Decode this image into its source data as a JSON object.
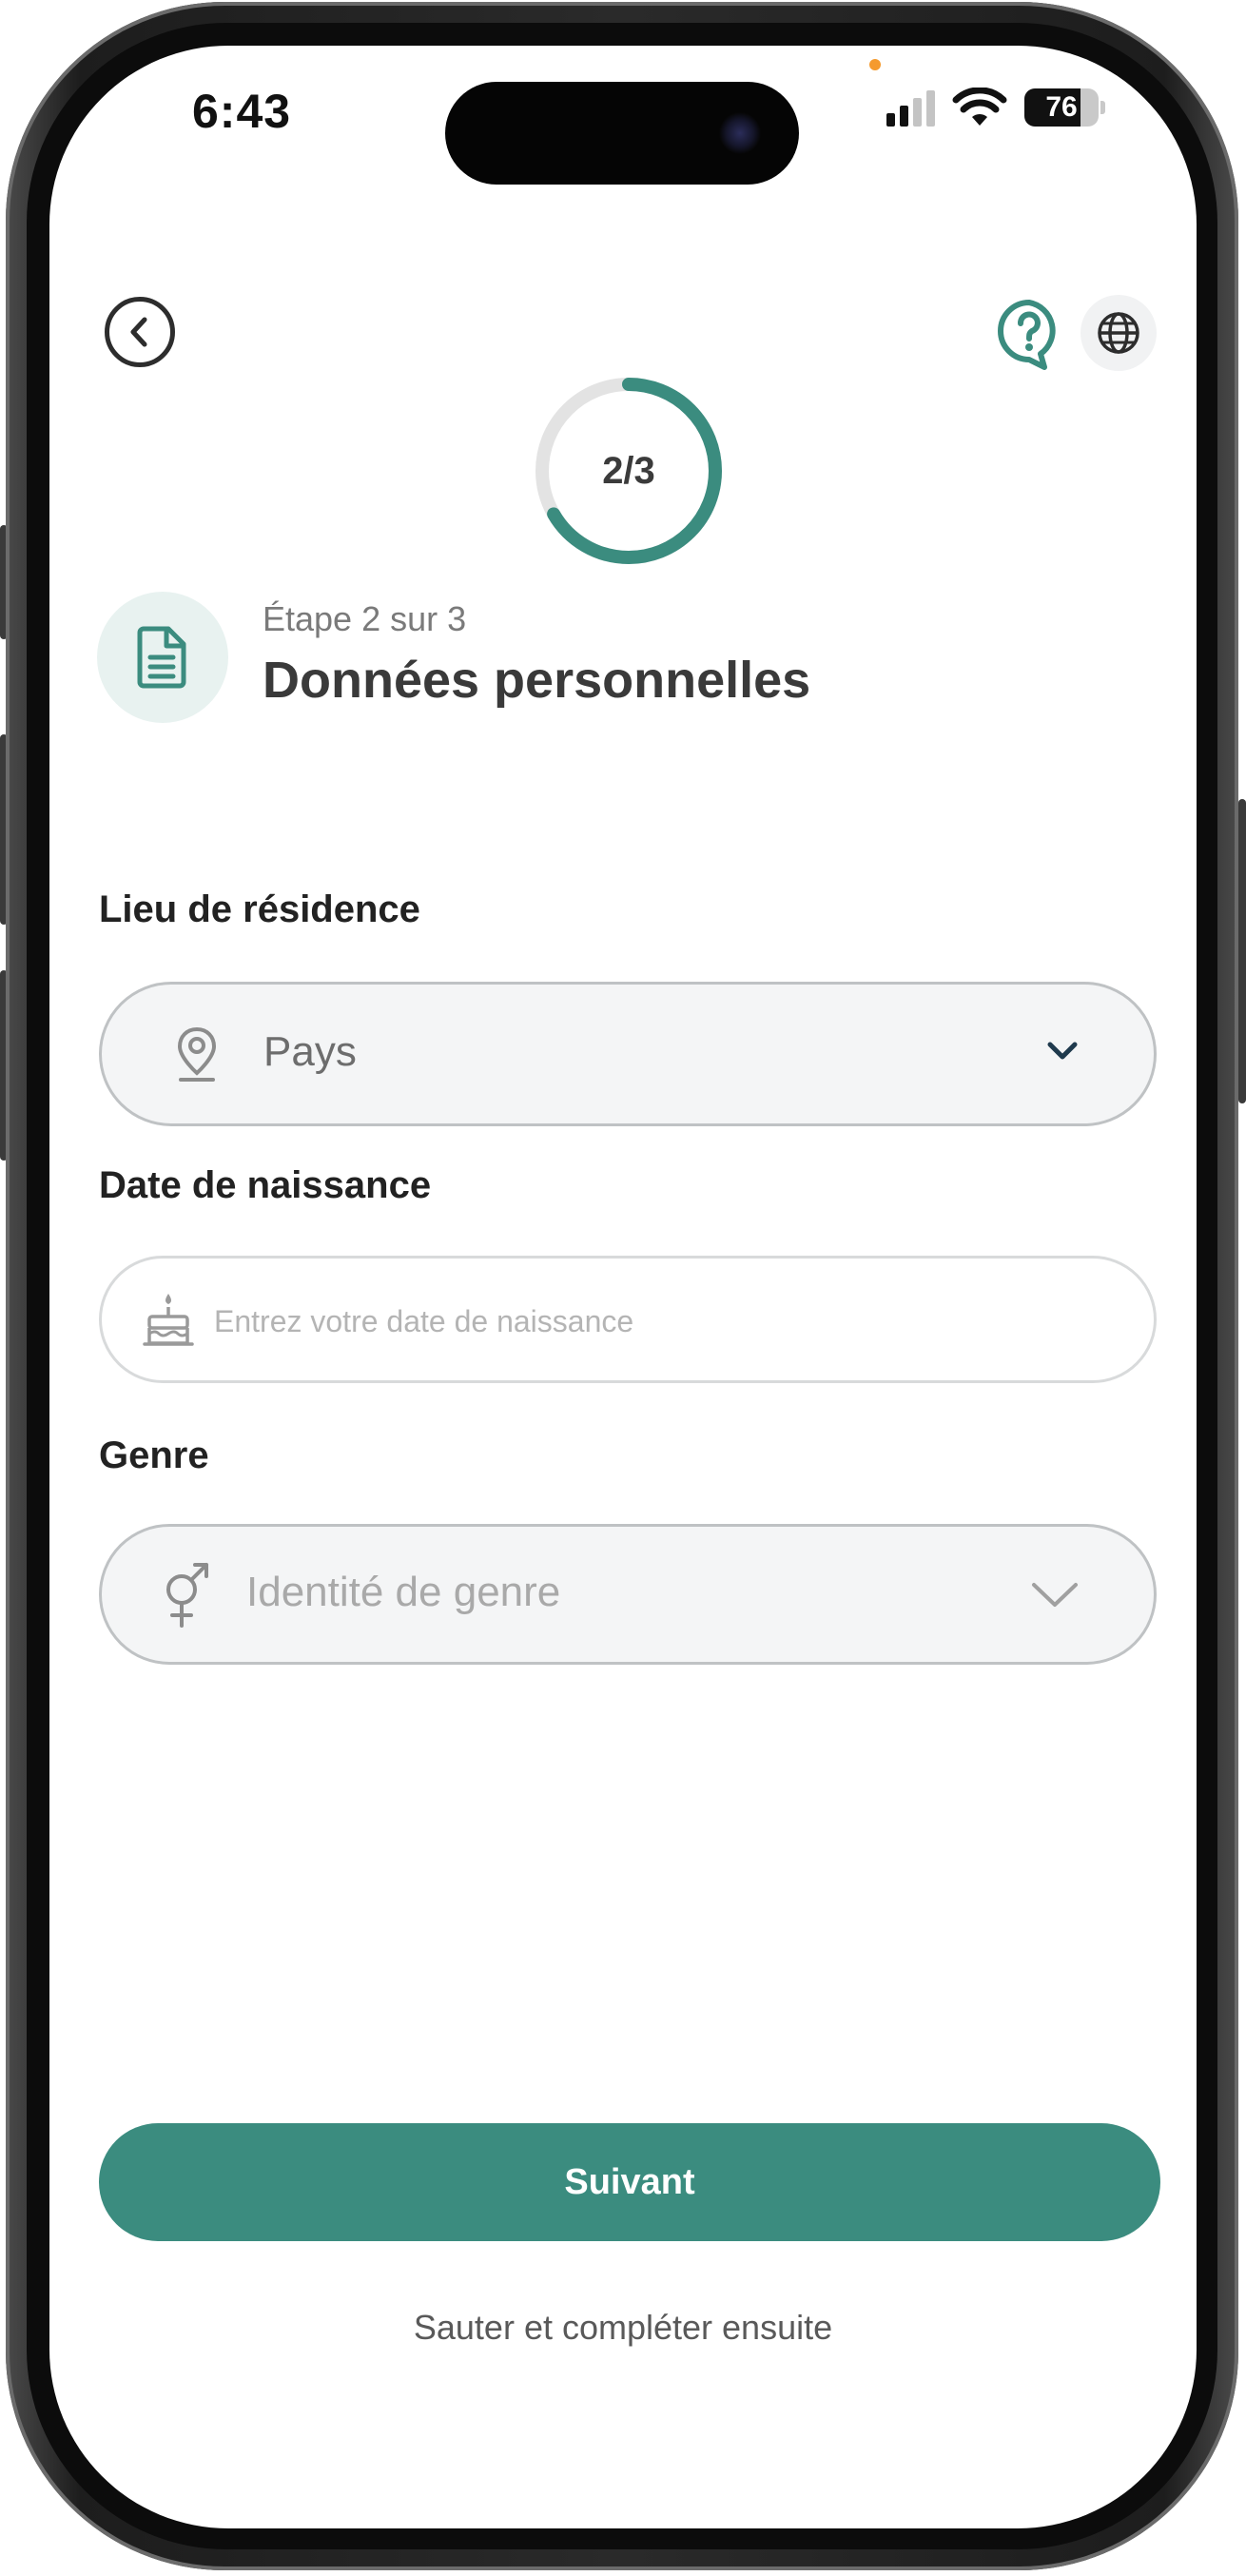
{
  "status_bar": {
    "time": "6:43",
    "battery": "76",
    "battery_level": 0.76
  },
  "header": {
    "back_icon": "chevron-left-icon",
    "help_icon": "question-bubble-icon",
    "language_icon": "globe-icon"
  },
  "progress": {
    "label": "2/3",
    "fraction": 0.6667,
    "color": "#3b8c7f",
    "track_color": "#e3e3e3"
  },
  "step": {
    "icon": "document-icon",
    "caption": "Étape 2 sur 3",
    "title": "Données personnelles"
  },
  "form": {
    "residence": {
      "label": "Lieu de résidence",
      "value": "Pays",
      "icon": "location-pin-icon"
    },
    "birthdate": {
      "label": "Date de naissance",
      "placeholder": "Entrez votre date de naissance",
      "icon": "birthday-cake-icon"
    },
    "gender": {
      "label": "Genre",
      "placeholder": "Identité de genre",
      "icon": "gender-symbol-icon"
    }
  },
  "actions": {
    "next_label": "Suivant",
    "skip_label": "Sauter et compléter ensuite"
  },
  "colors": {
    "accent": "#3b8c7f",
    "accent_light": "#e8f2f0",
    "field_bg": "#f4f5f6"
  }
}
